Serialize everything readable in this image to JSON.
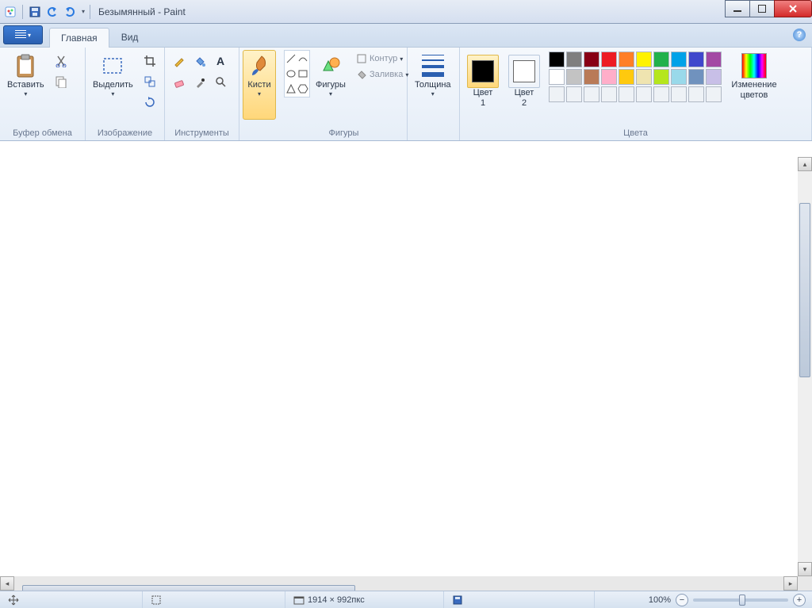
{
  "title": "Безымянный - Paint",
  "tabs": {
    "home": "Главная",
    "view": "Вид"
  },
  "groups": {
    "clipboard": {
      "label": "Буфер обмена",
      "paste": "Вставить"
    },
    "image": {
      "label": "Изображение",
      "select": "Выделить"
    },
    "tools": {
      "label": "Инструменты",
      "brushes": "Кисти"
    },
    "shapes": {
      "label": "Фигуры",
      "btn": "Фигуры",
      "outline": "Контур",
      "fill": "Заливка"
    },
    "size": {
      "label": "Толщина"
    },
    "colors": {
      "label": "Цвета",
      "c1": "Цвет\n1",
      "c2": "Цвет\n2",
      "edit": "Изменение\nцветов",
      "row1": [
        "#000000",
        "#7f7f7f",
        "#880015",
        "#ed1c24",
        "#ff7f27",
        "#fff200",
        "#22b14c",
        "#00a2e8",
        "#3f48cc",
        "#a349a4"
      ],
      "row2": [
        "#ffffff",
        "#c3c3c3",
        "#b97a57",
        "#ffaec9",
        "#ffc90e",
        "#efe4b0",
        "#b5e61d",
        "#99d9ea",
        "#7092be",
        "#c8bfe7"
      ],
      "c1val": "#000000",
      "c2val": "#ffffff"
    }
  },
  "status": {
    "dims": "1914 × 992пкс",
    "zoom": "100%"
  }
}
